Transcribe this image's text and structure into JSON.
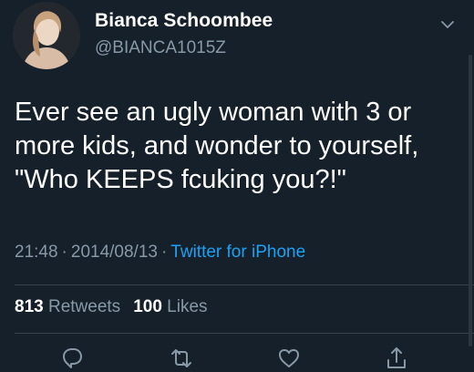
{
  "user": {
    "display_name": "Bianca Schoombee",
    "handle": "@BIANCA1015Z",
    "avatar_icon": "profile-photo"
  },
  "tweet": {
    "text": "Ever see an ugly woman with 3 or\nmore kids, and wonder to yourself,\n\"Who KEEPS fcuking you?!\"",
    "time": "21:48",
    "date": "2014/08/13",
    "separator": "·",
    "source": "Twitter for iPhone"
  },
  "stats": {
    "retweets_count": "813",
    "retweets_label": "Retweets",
    "likes_count": "100",
    "likes_label": "Likes"
  },
  "actions": {
    "reply_icon": "reply-icon",
    "retweet_icon": "retweet-icon",
    "like_icon": "heart-icon",
    "share_icon": "share-icon"
  },
  "colors": {
    "background": "#15202b",
    "secondary_text": "#8899a6",
    "link": "#1da1f2",
    "divider": "#38444d"
  }
}
